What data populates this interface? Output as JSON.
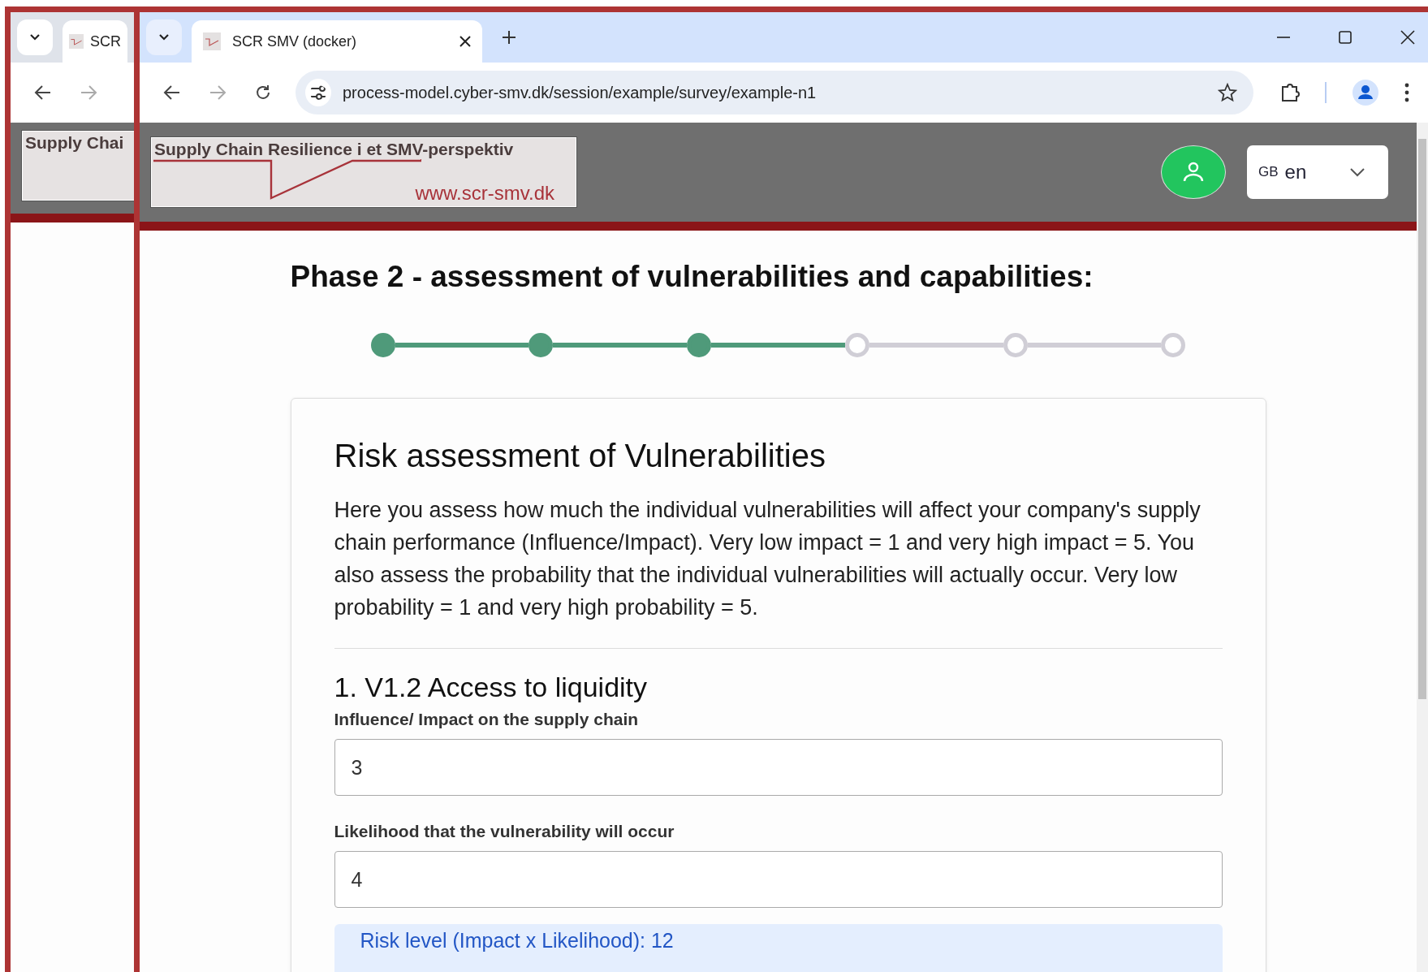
{
  "back_window": {
    "tab": {
      "title": "SCR"
    },
    "logo": {
      "title": "Supply Chai"
    }
  },
  "window": {
    "tab": {
      "title": "SCR SMV (docker)"
    },
    "address": "process-model.cyber-smv.dk/session/example/survey/example-n1"
  },
  "header": {
    "logo": {
      "title": "Supply Chain Resilience i et SMV-perspektiv",
      "url": "www.scr-smv.dk"
    },
    "language": {
      "flag": "GB",
      "code": "en"
    }
  },
  "page_title": "Phase 2 - assessment of vulnerabilities and capabilities:",
  "steps": [
    {
      "completed": true
    },
    {
      "completed": true
    },
    {
      "completed": true
    },
    {
      "completed": false
    },
    {
      "completed": false
    },
    {
      "completed": false
    }
  ],
  "card": {
    "title": "Risk assessment of Vulnerabilities",
    "intro": "Here you assess how much the individual vulnerabilities will affect your company's supply chain performance (Influence/Impact). Very low impact = 1 and very high impact = 5. You also assess the probability that the individual vulnerabilities will actually occur. Very low probability = 1 and very high probability = 5.",
    "question": {
      "title": "1. V1.2 Access to liquidity",
      "fields": [
        {
          "label": "Influence/ Impact on the supply chain",
          "value": "3"
        },
        {
          "label": "Likelihood that the vulnerability will occur",
          "value": "4"
        }
      ],
      "result": "Risk level (Impact x Likelihood): 12"
    }
  }
}
